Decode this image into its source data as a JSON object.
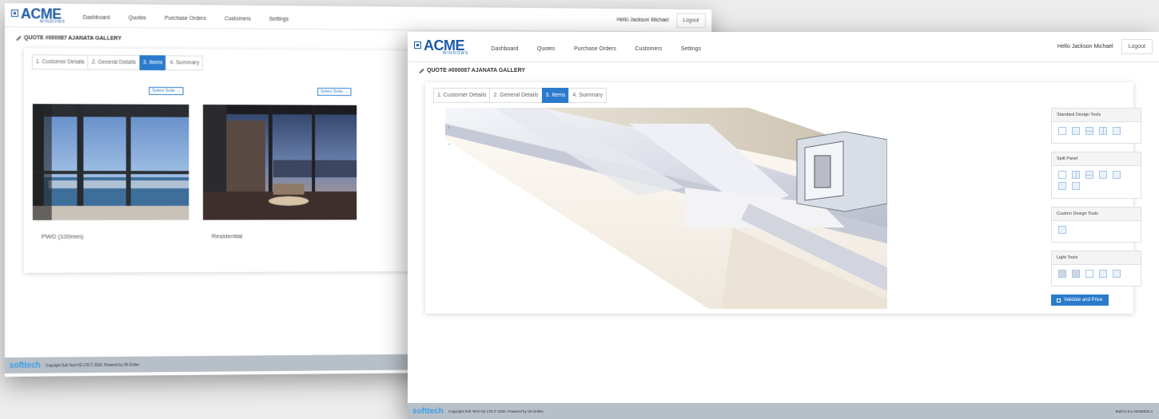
{
  "app": {
    "brand": "ACME",
    "brand_sub": "WINDOWS",
    "nav": [
      "Dashboard",
      "Quotes",
      "Purchase Orders",
      "Customers",
      "Settings"
    ],
    "greeting": "Hello Jackson Michael",
    "logout": "Logout"
  },
  "quote": {
    "title": "QUOTE #000087 AJANATA GALLERY"
  },
  "tabs": [
    "1. Customer Details",
    "2. General Details",
    "3. Items",
    "4. Summary"
  ],
  "active_tab": "3. Items",
  "suites": [
    {
      "name": "PWD (100mm)",
      "select_label": "Select Suite →"
    },
    {
      "name": "Residential",
      "select_label": "Select Suite →"
    }
  ],
  "tool_panel": {
    "groups": [
      {
        "title": "Standard Design Tools"
      },
      {
        "title": "Split Panel"
      },
      {
        "title": "Custom Design Tools"
      },
      {
        "title": "Light Tools"
      }
    ],
    "validate_button": "Validate and Price"
  },
  "footer": {
    "brand_a": "soft",
    "brand_b": "tech",
    "copyright": "Copyright Soft Tech NZ LTD © 2020. Powered by V6 Online",
    "build": "Build 0.0.a 20200020.4"
  },
  "colors": {
    "accent": "#2b7bcc",
    "brand": "#1e5aa8",
    "footer": "#b7bfc9"
  }
}
